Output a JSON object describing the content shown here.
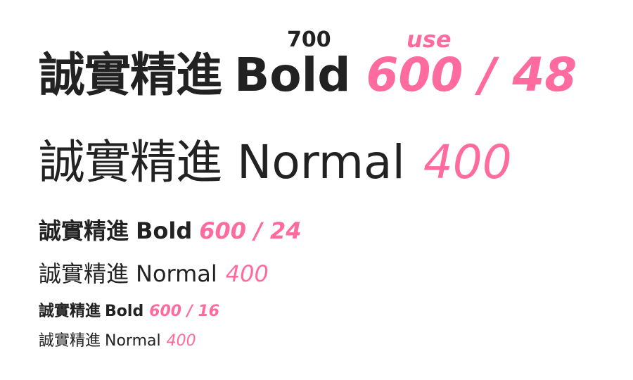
{
  "annotations": {
    "weight_700": "700",
    "use_note": "use"
  },
  "specimens": [
    {
      "cjk": "誠實精進",
      "word": "Bold",
      "spec": "600 / 48"
    },
    {
      "cjk": "誠實精進",
      "word": "Normal",
      "spec": "400"
    },
    {
      "cjk": "誠實精進",
      "word": "Bold",
      "spec": "600 / 24"
    },
    {
      "cjk": "誠實精進",
      "word": "Normal",
      "spec": "400"
    },
    {
      "cjk": "誠實精進",
      "word": "Bold",
      "spec": "600 / 16"
    },
    {
      "cjk": "誠實精進",
      "word": "Normal",
      "spec": "400"
    }
  ],
  "colors": {
    "text": "#222222",
    "accent": "#ff6b9e",
    "background": "#ffffff"
  }
}
